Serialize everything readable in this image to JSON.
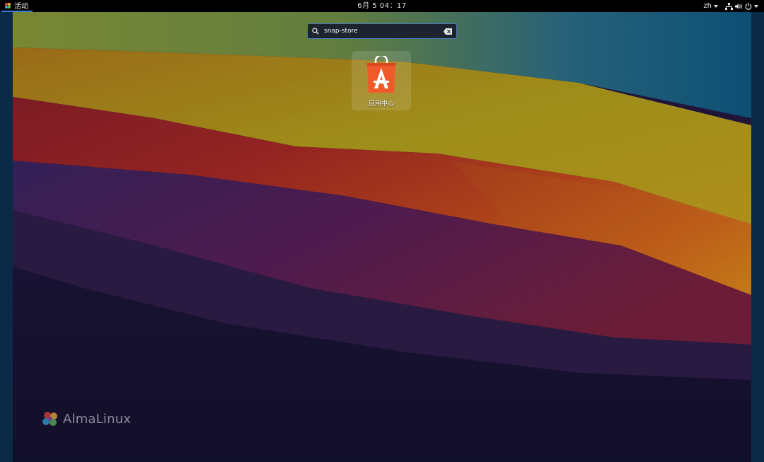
{
  "topbar": {
    "activities_label": "活动",
    "clock": "6月 5  04：17",
    "language": "zh"
  },
  "search": {
    "value": "snap-store",
    "placeholder": ""
  },
  "results": [
    {
      "label": "应用中心",
      "icon": "software-store-icon"
    }
  ],
  "branding": {
    "text": "AlmaLinux"
  },
  "colors": {
    "accent": "#4a7ab8",
    "app_icon": "#f05a2a",
    "topbar": "#000000"
  }
}
